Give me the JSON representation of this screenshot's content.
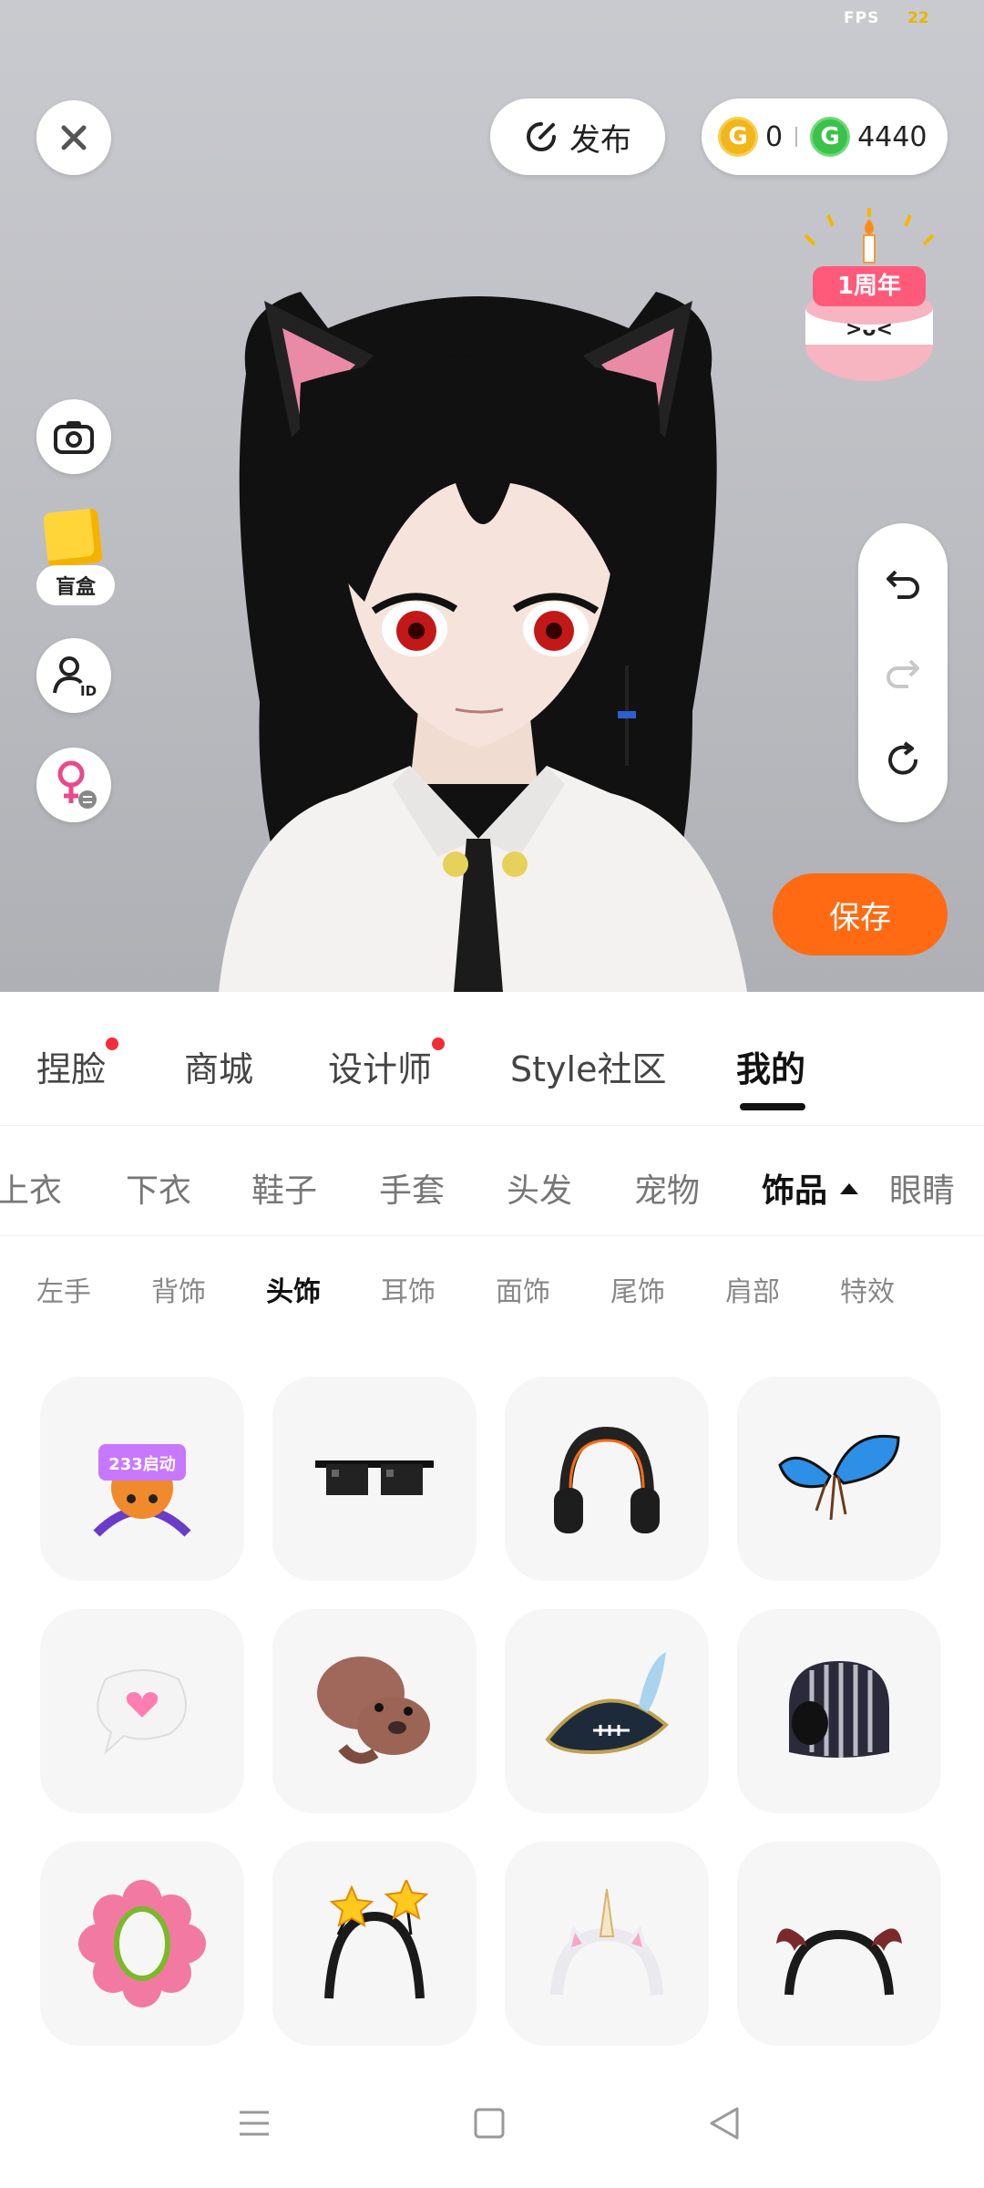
{
  "status": {
    "fps_label": "FPS",
    "fps_value": "22"
  },
  "top": {
    "publish_label": "发布",
    "gold_coins": "0",
    "green_coins": "4440"
  },
  "left_tools": {
    "blind_box_label": "盲盒"
  },
  "anniversary_badge": "1周年",
  "save_label": "保存",
  "tabs": [
    {
      "label": "捏脸",
      "dot": true
    },
    {
      "label": "商城",
      "dot": false
    },
    {
      "label": "设计师",
      "dot": true
    },
    {
      "label": "Style社区",
      "dot": false
    },
    {
      "label": "我的",
      "dot": false,
      "active": true
    }
  ],
  "categories": [
    "上衣",
    "下衣",
    "鞋子",
    "手套",
    "头发",
    "宠物",
    "饰品",
    "眼睛"
  ],
  "active_category": "饰品",
  "subcategories": [
    "左手",
    "背饰",
    "头饰",
    "耳饰",
    "面饰",
    "尾饰",
    "肩部",
    "特效"
  ],
  "active_subcategory": "头饰",
  "items": [
    {
      "icon": "233-launch-headpiece-icon",
      "text": "233启动"
    },
    {
      "icon": "pixel-sunglasses-icon"
    },
    {
      "icon": "headphones-icon"
    },
    {
      "icon": "blue-butterfly-icon"
    },
    {
      "icon": "heart-speech-bubble-icon"
    },
    {
      "icon": "seal-plush-icon"
    },
    {
      "icon": "pirate-hat-icon"
    },
    {
      "icon": "knit-hood-icon"
    },
    {
      "icon": "pink-flower-headband-icon"
    },
    {
      "icon": "star-headband-icon"
    },
    {
      "icon": "unicorn-headband-icon"
    },
    {
      "icon": "bat-wing-headband-icon"
    }
  ],
  "colors": {
    "accent": "#ff6a13",
    "dot": "#f42c35",
    "gold": "#f2b61b",
    "green": "#3bc24a"
  }
}
